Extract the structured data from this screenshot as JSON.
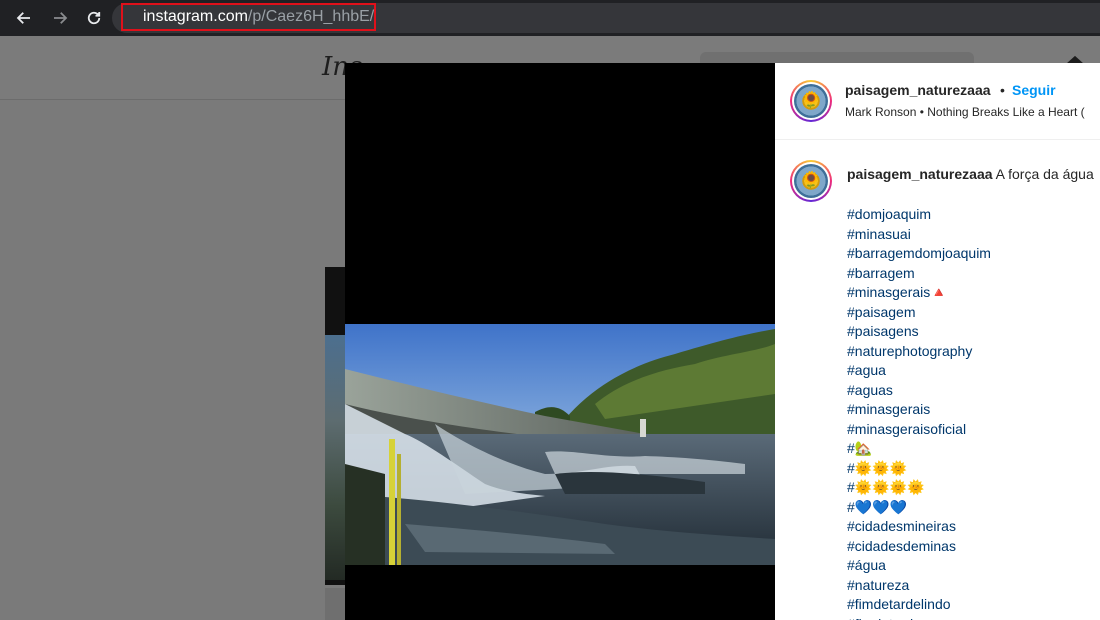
{
  "browser": {
    "url_host": "instagram.com",
    "url_path": "/p/Caez6H_hhbE/"
  },
  "instagram": {
    "logo_text": "Ins"
  },
  "post": {
    "username": "paisagem_naturezaaa",
    "separator": "•",
    "follow_label": "Seguir",
    "audio": "Mark Ronson • Nothing Breaks Like a Heart (",
    "caption_user": "paisagem_naturezaaa",
    "caption_text": "A força da água",
    "hashtags": [
      "#domjoaquim",
      "#minasuai",
      "#barragemdomjoaquim",
      "#barragem",
      "#minasgerais",
      "#paisagem",
      "#paisagens",
      "#naturephotography",
      "#agua",
      "#aguas",
      "#minasgerais",
      "#minasgeraisoficial",
      "#",
      "#",
      "#",
      "#",
      "#cidadesmineiras",
      "#cidadesdeminas",
      "#água",
      "#natureza",
      "#fimdetardelindo",
      "#fimdetarde"
    ],
    "hashtag_emojis": [
      "",
      "",
      "",
      "",
      "🔺",
      "",
      "",
      "",
      "",
      "",
      "",
      "",
      "🏡",
      "🌞🌞🌞",
      "🌞🌞🌞🌞",
      "💙💙💙",
      "",
      "",
      "",
      "",
      "",
      ""
    ]
  },
  "colors": {
    "accent": "#0095f6",
    "hashtag": "#00376b",
    "highlight_box": "#e0101a"
  }
}
